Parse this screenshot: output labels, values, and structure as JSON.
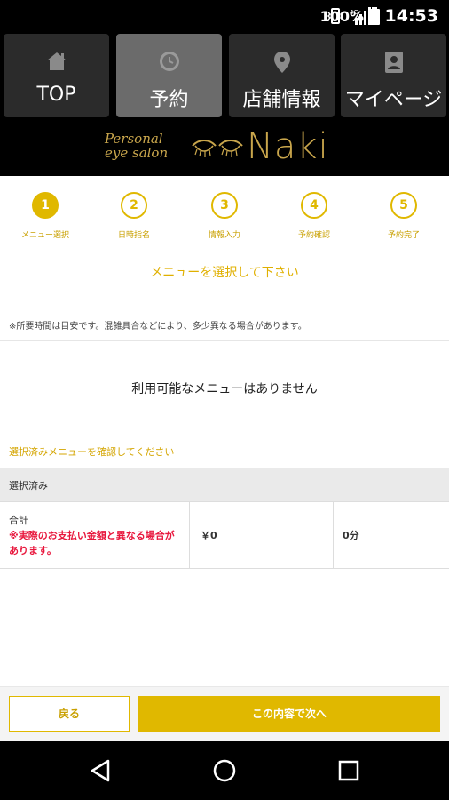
{
  "status_bar": {
    "battery_text": "100%",
    "time": "14:53",
    "network_label": "4G"
  },
  "nav": {
    "items": [
      {
        "label": "TOP",
        "icon": "home-icon"
      },
      {
        "label": "予約",
        "icon": "clock-icon"
      },
      {
        "label": "店舗情報",
        "icon": "location-pin-icon"
      },
      {
        "label": "マイページ",
        "icon": "user-card-icon"
      }
    ],
    "active_index": 1
  },
  "brand": {
    "line1": "Personal",
    "line2": "eye salon",
    "name": "Naki",
    "color": "#c9a64c"
  },
  "steps": [
    {
      "number": "1",
      "caption": "メニュー選択"
    },
    {
      "number": "2",
      "caption": "日時指名"
    },
    {
      "number": "3",
      "caption": "情報入力"
    },
    {
      "number": "4",
      "caption": "予約確認"
    },
    {
      "number": "5",
      "caption": "予約完了"
    }
  ],
  "main": {
    "select_title": "メニューを選択して下さい",
    "note": "※所要時間は目安です。混雑具合などにより、多少異なる場合があります。",
    "empty_message": "利用可能なメニューはありません",
    "confirm_link": "選択済みメニューを確認してください"
  },
  "summary": {
    "header": "選択済み",
    "total_label": "合計",
    "warning": "※実際のお支払い金額と異なる場合があります。",
    "price": "￥0",
    "duration": "0分"
  },
  "buttons": {
    "back": "戻る",
    "next": "この内容で次へ"
  },
  "colors": {
    "accent": "#e0b800",
    "warning": "#e8163c",
    "nav_active": "#6b6b6b",
    "nav_inactive": "#2b2b2b"
  }
}
